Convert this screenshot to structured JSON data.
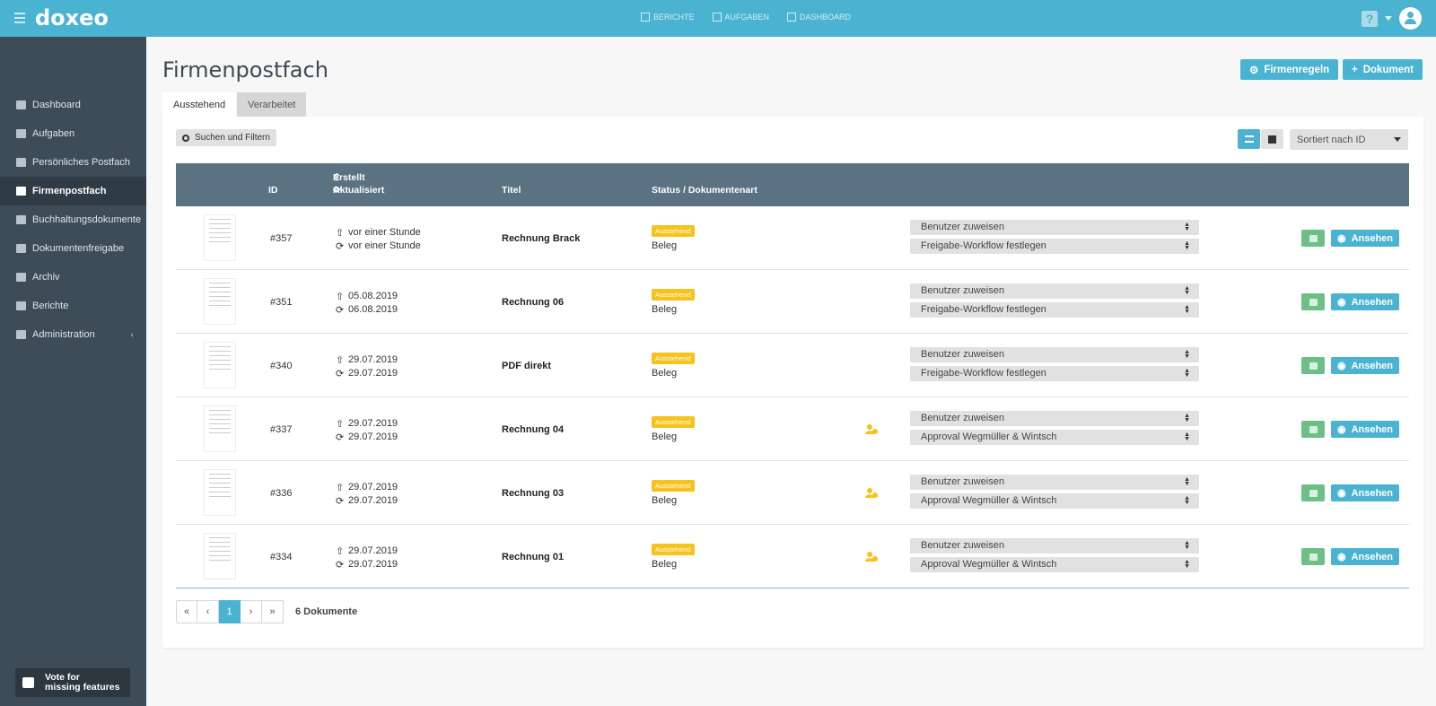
{
  "brand": {
    "logo": "doxeo",
    "accent": "#4ab3d1",
    "sidebar_bg": "#3e4c58"
  },
  "topnav": [
    {
      "label": "BERICHTE",
      "icon": "report-icon"
    },
    {
      "label": "AUFGABEN",
      "icon": "tasks-icon"
    },
    {
      "label": "DASHBOARD",
      "icon": "dashboard-icon"
    }
  ],
  "help": "?",
  "sidebar": {
    "items": [
      {
        "label": "Dashboard",
        "icon": "dashboard-icon"
      },
      {
        "label": "Aufgaben",
        "icon": "tasks-icon"
      },
      {
        "label": "Persönliches Postfach",
        "icon": "inbox-icon"
      },
      {
        "label": "Firmenpostfach",
        "icon": "company-inbox-icon",
        "active": true
      },
      {
        "label": "Buchhaltungsdokumente",
        "icon": "list-icon"
      },
      {
        "label": "Dokumentenfreigabe",
        "icon": "document-icon"
      },
      {
        "label": "Archiv",
        "icon": "archive-icon"
      },
      {
        "label": "Berichte",
        "icon": "report-icon"
      },
      {
        "label": "Administration",
        "icon": "gear-icon",
        "arrow": "‹"
      }
    ],
    "vote_line1": "Vote for",
    "vote_line2": "missing features"
  },
  "page": {
    "title": "Firmenpostfach",
    "btn_rules": "Firmenregeln",
    "btn_document": "Dokument",
    "tabs": [
      "Ausstehend",
      "Verarbeitet"
    ],
    "search_label": "Suchen und Filtern",
    "sort_label": "Sortiert nach ID"
  },
  "table": {
    "headers": {
      "id": "ID",
      "created": "Erstellt",
      "updated": "Aktualisiert",
      "title": "Titel",
      "status": "Status / Dokumentenart"
    },
    "rows": [
      {
        "id": "#357",
        "created": "vor einer Stunde",
        "updated": "vor einer Stunde",
        "title": "Rechnung Brack",
        "status": "Ausstehend",
        "type": "Beleg",
        "assign": "Benutzer zuweisen",
        "workflow": "Freigabe-Workflow festlegen",
        "user_icon": false,
        "view": "Ansehen"
      },
      {
        "id": "#351",
        "created": "05.08.2019",
        "updated": "06.08.2019",
        "title": "Rechnung 06",
        "status": "Ausstehend",
        "type": "Beleg",
        "assign": "Benutzer zuweisen",
        "workflow": "Freigabe-Workflow festlegen",
        "user_icon": false,
        "view": "Ansehen"
      },
      {
        "id": "#340",
        "created": "29.07.2019",
        "updated": "29.07.2019",
        "title": "PDF direkt",
        "status": "Ausstehend",
        "type": "Beleg",
        "assign": "Benutzer zuweisen",
        "workflow": "Freigabe-Workflow festlegen",
        "user_icon": false,
        "view": "Ansehen"
      },
      {
        "id": "#337",
        "created": "29.07.2019",
        "updated": "29.07.2019",
        "title": "Rechnung 04",
        "status": "Ausstehend",
        "type": "Beleg",
        "assign": "Benutzer zuweisen",
        "workflow": "Approval Wegmüller & Wintsch",
        "user_icon": true,
        "view": "Ansehen"
      },
      {
        "id": "#336",
        "created": "29.07.2019",
        "updated": "29.07.2019",
        "title": "Rechnung 03",
        "status": "Ausstehend",
        "type": "Beleg",
        "assign": "Benutzer zuweisen",
        "workflow": "Approval Wegmüller & Wintsch",
        "user_icon": true,
        "view": "Ansehen"
      },
      {
        "id": "#334",
        "created": "29.07.2019",
        "updated": "29.07.2019",
        "title": "Rechnung 01",
        "status": "Ausstehend",
        "type": "Beleg",
        "assign": "Benutzer zuweisen",
        "workflow": "Approval Wegmüller & Wintsch",
        "user_icon": true,
        "view": "Ansehen"
      }
    ]
  },
  "pagination": {
    "first": "«",
    "prev": "‹",
    "current": "1",
    "next": "›",
    "last": "»",
    "count": "6 Dokumente"
  }
}
